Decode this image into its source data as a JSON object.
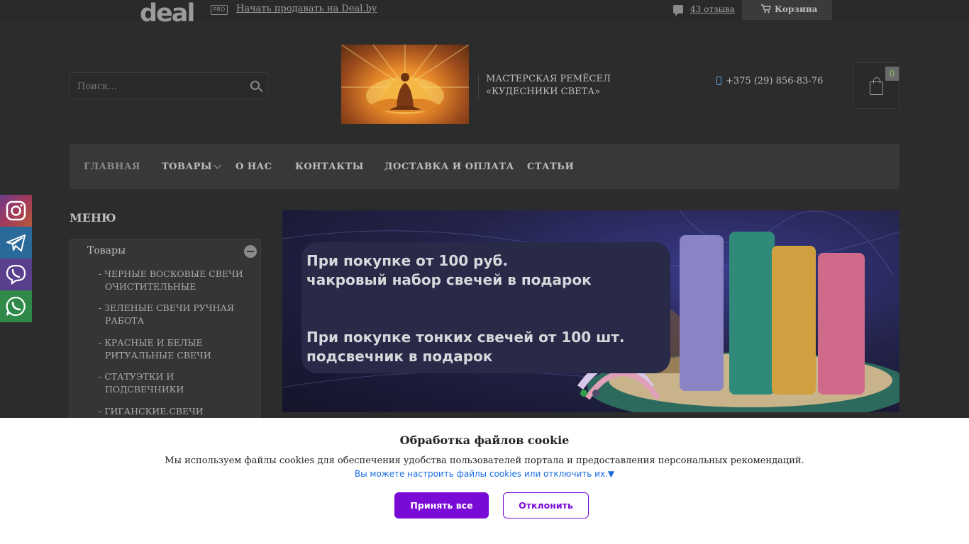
{
  "topbar": {
    "logo": "deal",
    "pro_badge": "PRO",
    "sell_link": "Начать продавать на Deal.by",
    "reviews_link": "43 отзыва",
    "cart_label": "Корзина"
  },
  "header": {
    "search_placeholder": "Поиск...",
    "shop_name_line1": "МАСТЕРСКАЯ РЕМЁСЕЛ",
    "shop_name_line2": "«КУДЕСНИКИ СВЕТА»",
    "phone": "+375 (29) 856-83-76",
    "cart_count": "0"
  },
  "nav": {
    "items": [
      "ГЛАВНАЯ",
      "ТОВАРЫ",
      "О НАС",
      "КОНТАКТЫ",
      "ДОСТАВКА И ОПЛАТА",
      "СТАТЬИ"
    ]
  },
  "social": [
    "instagram-icon",
    "telegram-icon",
    "viber-icon",
    "whatsapp-icon"
  ],
  "sidebar": {
    "title": "МЕНЮ",
    "category": "Товары",
    "items": [
      "- ЧЕРНЫЕ ВОСКОВЫЕ СВЕЧИ ОЧИСТИТЕЛЬНЫЕ",
      "- ЗЕЛЕНЫЕ СВЕЧИ РУЧНАЯ РАБОТА",
      "- КРАСНЫЕ И БЕЛЫЕ РИТУАЛЬНЫЕ СВЕЧИ",
      "- СТАТУЭТКИ И ПОДСВЕЧНИКИ",
      "- ГИГАНСКИЕ.СВЕЧИ РУЧНАЯ"
    ]
  },
  "banner": {
    "line1": "При покупке от 100 руб.",
    "line2": "чакровый набор свечей в подарок",
    "line3": "При покупке тонких свечей от 100 шт.",
    "line4": "подсвечник в  подарок",
    "active_dot_color": "#2e9e4a"
  },
  "cookie": {
    "title": "Обработка файлов cookie",
    "text": "Мы используем файлы cookies для обеспечения удобства пользователей портала и предоставления персональных рекомендаций.",
    "link": "Вы можете настроить файлы cookies или отключить их.▼",
    "accept": "Принять все",
    "decline": "Отклонить",
    "accent_color": "#7a0ad6"
  }
}
